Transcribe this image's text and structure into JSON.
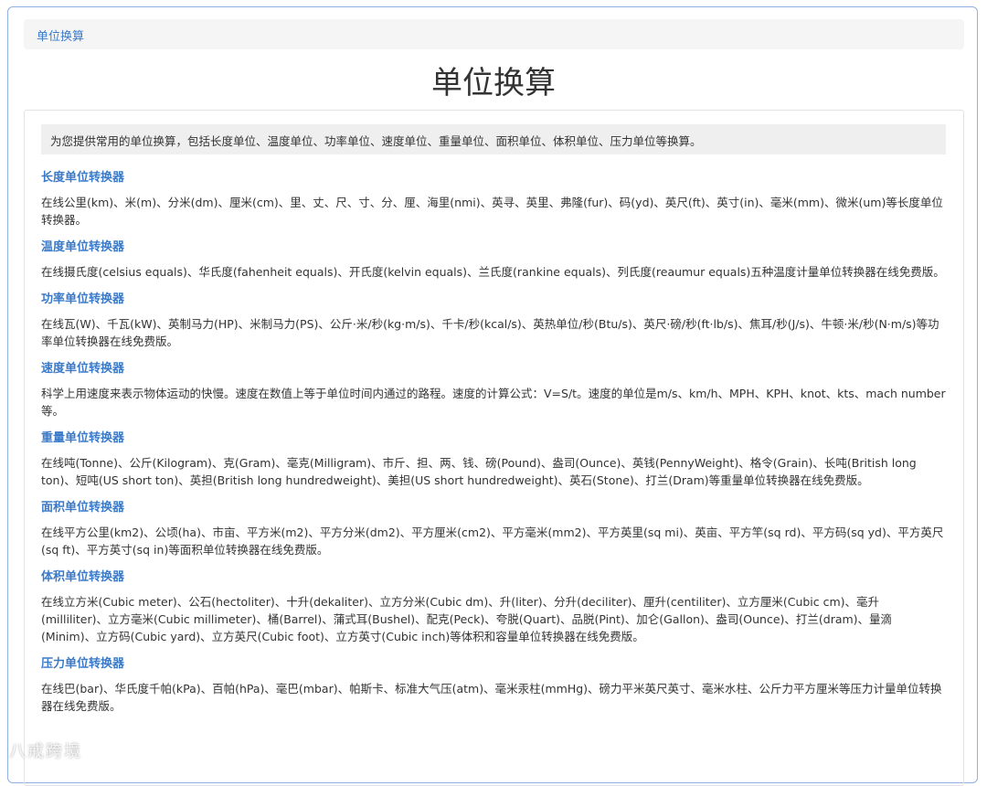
{
  "breadcrumb": {
    "label": "单位换算"
  },
  "page": {
    "title": "单位换算"
  },
  "intro": "为您提供常用的单位换算，包括长度单位、温度单位、功率单位、速度单位、重量单位、面积单位、体积单位、压力单位等换算。",
  "sections": [
    {
      "title": "长度单位转换器",
      "desc": "在线公里(km)、米(m)、分米(dm)、厘米(cm)、里、丈、尺、寸、分、厘、海里(nmi)、英寻、英里、弗隆(fur)、码(yd)、英尺(ft)、英寸(in)、毫米(mm)、微米(um)等长度单位转换器。"
    },
    {
      "title": "温度单位转换器",
      "desc": "在线摄氏度(celsius equals)、华氏度(fahenheit equals)、开氏度(kelvin equals)、兰氏度(rankine equals)、列氏度(reaumur equals)五种温度计量单位转换器在线免费版。"
    },
    {
      "title": "功率单位转换器",
      "desc": "在线瓦(W)、千瓦(kW)、英制马力(HP)、米制马力(PS)、公斤·米/秒(kg·m/s)、千卡/秒(kcal/s)、英热单位/秒(Btu/s)、英尺·磅/秒(ft·lb/s)、焦耳/秒(J/s)、牛顿·米/秒(N·m/s)等功率单位转换器在线免费版。"
    },
    {
      "title": "速度单位转换器",
      "desc": "科学上用速度来表示物体运动的快慢。速度在数值上等于单位时间内通过的路程。速度的计算公式：V=S/t。速度的单位是m/s、km/h、MPH、KPH、knot、kts、mach number等。"
    },
    {
      "title": "重量单位转换器",
      "desc": "在线吨(Tonne)、公斤(Kilogram)、克(Gram)、毫克(Milligram)、市斤、担、两、钱、磅(Pound)、盎司(Ounce)、英钱(PennyWeight)、格令(Grain)、长吨(British long ton)、短吨(US short ton)、英担(British long hundredweight)、美担(US short hundredweight)、英石(Stone)、打兰(Dram)等重量单位转换器在线免费版。"
    },
    {
      "title": "面积单位转换器",
      "desc": "在线平方公里(km2)、公顷(ha)、市亩、平方米(m2)、平方分米(dm2)、平方厘米(cm2)、平方毫米(mm2)、平方英里(sq mi)、英亩、平方竿(sq rd)、平方码(sq yd)、平方英尺(sq ft)、平方英寸(sq in)等面积单位转换器在线免费版。"
    },
    {
      "title": "体积单位转换器",
      "desc": "在线立方米(Cubic meter)、公石(hectoliter)、十升(dekaliter)、立方分米(Cubic dm)、升(liter)、分升(deciliter)、厘升(centiliter)、立方厘米(Cubic cm)、毫升(milliliter)、立方毫米(Cubic millimeter)、桶(Barrel)、蒲式耳(Bushel)、配克(Peck)、夸脱(Quart)、品脱(Pint)、加仑(Gallon)、盎司(Ounce)、打兰(dram)、量滴(Minim)、立方码(Cubic yard)、立方英尺(Cubic foot)、立方英寸(Cubic inch)等体积和容量单位转换器在线免费版。"
    },
    {
      "title": "压力单位转换器",
      "desc": "在线巴(bar)、华氏度千帕(kPa)、百帕(hPa)、毫巴(mbar)、帕斯卡、标准大气压(atm)、毫米汞柱(mmHg)、磅力平米英尺英寸、毫米水柱、公斤力平方厘米等压力计量单位转换器在线免费版。"
    }
  ],
  "watermark": "八戒跨境"
}
